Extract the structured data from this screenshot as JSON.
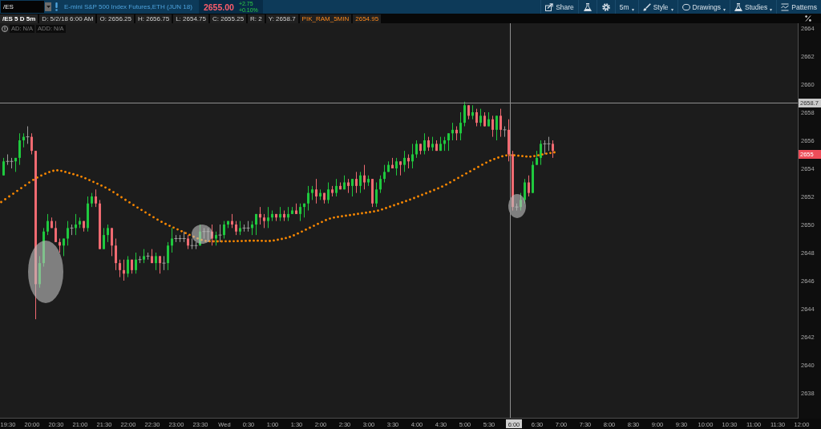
{
  "symbol_bar": {
    "symbol": "/ES",
    "description": "E-mini S&P 500 Index Futures,ETH (JUN 18)",
    "last_price": "2655.00",
    "net_change": "+2.75",
    "percent_change": "+0.10%"
  },
  "toolbar": [
    {
      "kind": "text",
      "label": "Share",
      "dropdown": false
    },
    {
      "kind": "icon",
      "dropdown": false
    },
    {
      "kind": "icon",
      "dropdown": false
    },
    {
      "kind": "text",
      "label": "5m",
      "dropdown": true
    },
    {
      "kind": "text",
      "label": "Style",
      "dropdown": true
    },
    {
      "kind": "text",
      "label": "Drawings",
      "dropdown": true
    },
    {
      "kind": "text",
      "label": "Studies",
      "dropdown": true
    },
    {
      "kind": "text",
      "label": "Patterns",
      "dropdown": false
    }
  ],
  "info_strip": {
    "title": "/ES 5 D 5m",
    "fields": [
      {
        "kind": "quote",
        "text": "D: 5/2/18 6:00 AM"
      },
      {
        "kind": "quote",
        "text": "O: 2656.25"
      },
      {
        "kind": "quote",
        "text": "H: 2656.75"
      },
      {
        "kind": "quote",
        "text": "L: 2654.75"
      },
      {
        "kind": "quote",
        "text": "C: 2655.25"
      },
      {
        "kind": "quote",
        "text": "R: 2"
      },
      {
        "kind": "quote",
        "text": "Y: 2658.7"
      },
      {
        "kind": "study",
        "text": "PIK_RAM_5MIN"
      },
      {
        "kind": "study",
        "text": "2654.95"
      }
    ]
  },
  "chart": {
    "indicators": [
      "AD: N/A",
      "ADD: N/A"
    ],
    "price_axis": {
      "labels": [
        "2664",
        "2662",
        "2660",
        "2658",
        "2656",
        "2654",
        "2652",
        "2650",
        "2648",
        "2646",
        "2644",
        "2642",
        "2640",
        "2638"
      ]
    },
    "crosshair": {
      "price_label": "2658.7",
      "time_label": "6:00"
    },
    "last_price_label": "2655",
    "time_axis": {
      "labels": [
        "19:30",
        "20:00",
        "20:30",
        "21:00",
        "21:30",
        "22:00",
        "22:30",
        "23:00",
        "23:30",
        "Wed",
        "0:30",
        "1:00",
        "1:30",
        "2:00",
        "2:30",
        "3:00",
        "3:30",
        "4:00",
        "4:30",
        "5:00",
        "5:30",
        "6:30",
        "7:00",
        "7:30",
        "8:00",
        "8:30",
        "9:00",
        "9:30",
        "10:00",
        "10:30",
        "11:00",
        "11:30",
        "12:00"
      ]
    }
  }
}
